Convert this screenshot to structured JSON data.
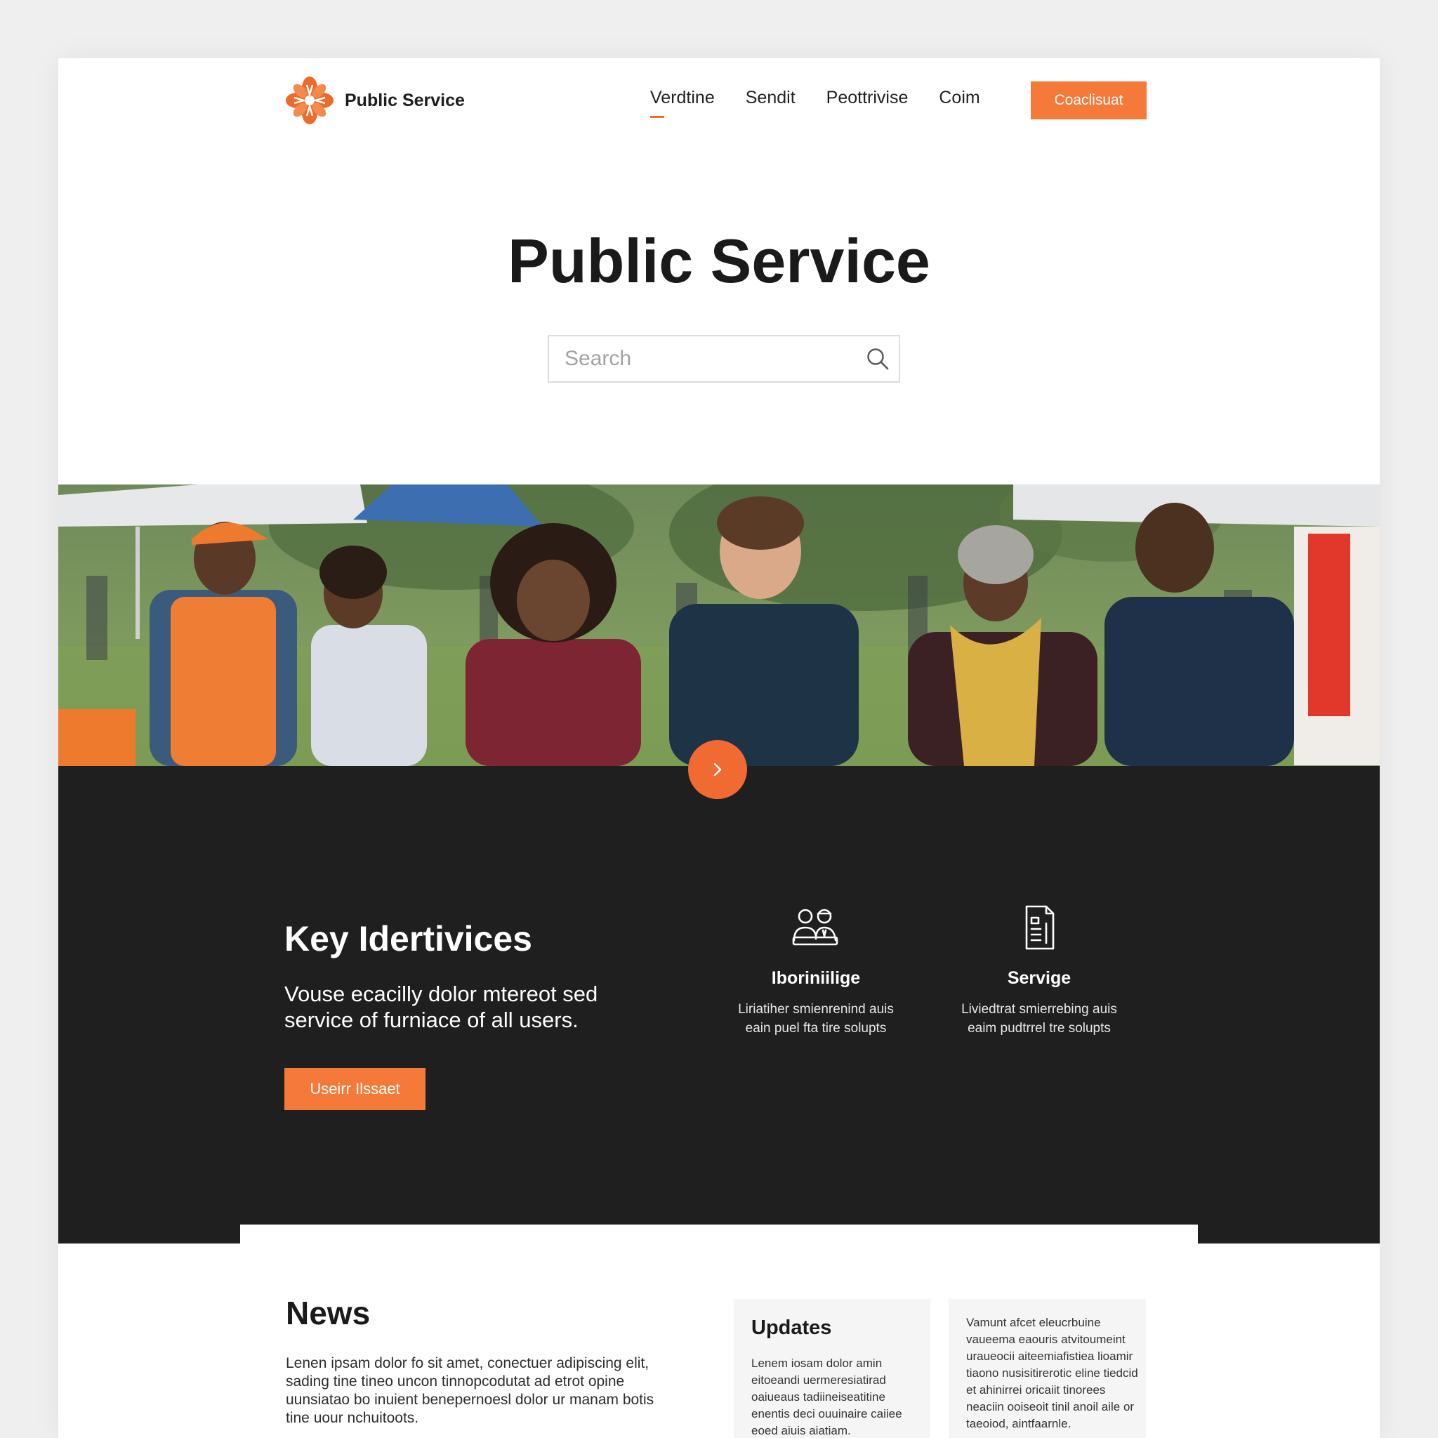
{
  "colors": {
    "accent": "#f57a3a",
    "dark_section": "#1f1f1f",
    "page_bg": "#ffffff",
    "outer_bg": "#efefef"
  },
  "header": {
    "brand_name": "Public Service",
    "logo_icon": "flower-logo-icon",
    "nav": [
      {
        "label": "Verdtine",
        "active": true
      },
      {
        "label": "Sendit",
        "active": false
      },
      {
        "label": "Peottrivise",
        "active": false
      },
      {
        "label": "Coim",
        "active": false
      }
    ],
    "cta_label": "Coaclisuat"
  },
  "hero": {
    "title": "Public Service",
    "search": {
      "placeholder": "Search",
      "value": "",
      "icon": "search-icon"
    }
  },
  "carousel": {
    "next_icon": "chevron-right-icon"
  },
  "key_services": {
    "title": "Key Idertivices",
    "description": "Vouse ecacilly dolor mtereot sed service of furniace of all users.",
    "button_label": "Useirr Ilssaet",
    "features": [
      {
        "icon": "people-icon",
        "title": "Iboriniilige",
        "text": "Liriatiher smienrenind auis eain puel fta tire solupts"
      },
      {
        "icon": "document-icon",
        "title": "Servige",
        "text": "Liviedtrat smierrebing auis eaim pudtrrel tre solupts"
      }
    ]
  },
  "news": {
    "title": "News",
    "text": "Lenen ipsam dolor fo sit amet, conectuer adipiscing elit, sading tine tineo uncon tinnopcodutat ad etrot opine uunsiatao bo inuient benepernoesl dolor ur manam botis tine uour nchuitoots."
  },
  "updates_card": {
    "title": "Updates",
    "text": "Lenem iosam dolor amin eitoeandi uermeresiatirad oaiueaus tadiineiseatitine enentis deci ouuinaire caiiee eoed aiuis aiatiam."
  },
  "more_card": {
    "text": "Vamunt afcet eleucrbuine vaueema eaouris atvitoumeint uraueocii aiteemiafistiea lioamir tiaono nusisitirerotic eline tiedcid et ahinirrei oricaiit tinorees neaciin ooiseoit tinil anoil aile or taeoiod, aintfaarnle."
  }
}
